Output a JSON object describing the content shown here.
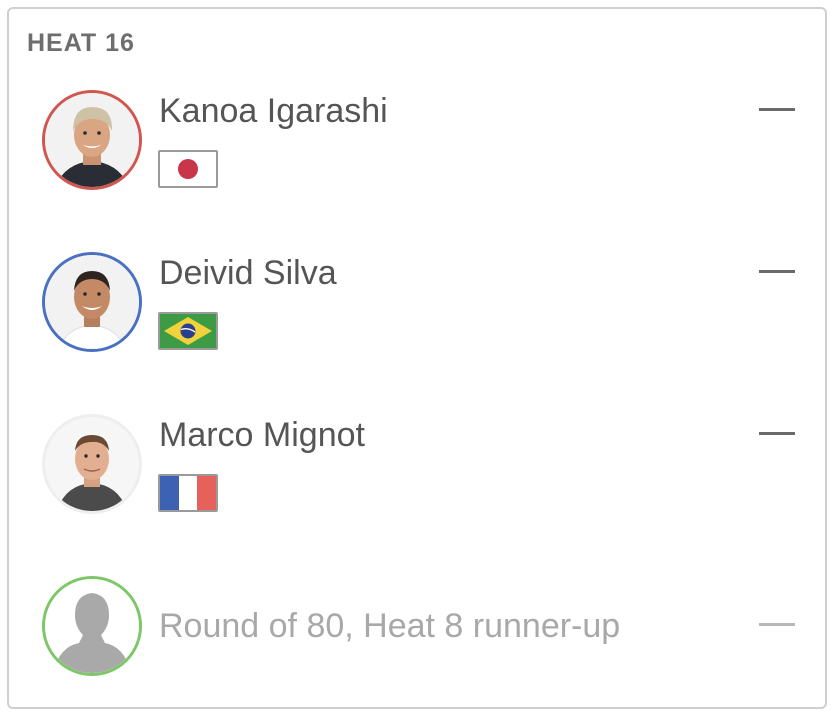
{
  "heat": {
    "title": "HEAT 16"
  },
  "athletes": [
    {
      "name": "Kanoa Igarashi",
      "country_flag": "Japan",
      "ring_color": "#d0564f",
      "score": "—"
    },
    {
      "name": "Deivid Silva",
      "country_flag": "Brazil",
      "ring_color": "#4a70c2",
      "score": "—"
    },
    {
      "name": "Marco Mignot",
      "country_flag": "France",
      "ring_color": "#eeeeee",
      "score": "—"
    },
    {
      "name": "Round of 80, Heat 8 runner-up",
      "country_flag": "",
      "ring_color": "#7cc766",
      "score": "—"
    }
  ],
  "icons": {
    "avatar_placeholder": "person-silhouette-icon",
    "score_placeholder": "dash-icon"
  }
}
